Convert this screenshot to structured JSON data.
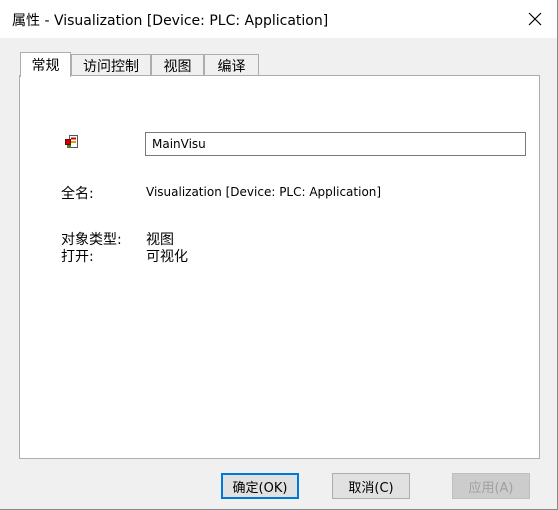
{
  "window": {
    "title": "属性 - Visualization [Device: PLC: Application]"
  },
  "tabs": [
    {
      "label": "常规",
      "active": true
    },
    {
      "label": "访问控制",
      "active": false
    },
    {
      "label": "视图",
      "active": false
    },
    {
      "label": "编译",
      "active": false
    }
  ],
  "general": {
    "icon": "visualization-object-icon",
    "name_value": "MainVisu",
    "full_name_label": "全名:",
    "full_name_value": "Visualization [Device: PLC: Application]",
    "object_type_label": "对象类型:",
    "object_type_value": "视图",
    "open_label": "打开:",
    "open_value": "可视化"
  },
  "buttons": {
    "ok": "确定(OK)",
    "cancel": "取消(C)",
    "apply": "应用(A)"
  },
  "colors": {
    "default_button_border": "#0078d7",
    "disabled_text": "#a0a0a0"
  }
}
